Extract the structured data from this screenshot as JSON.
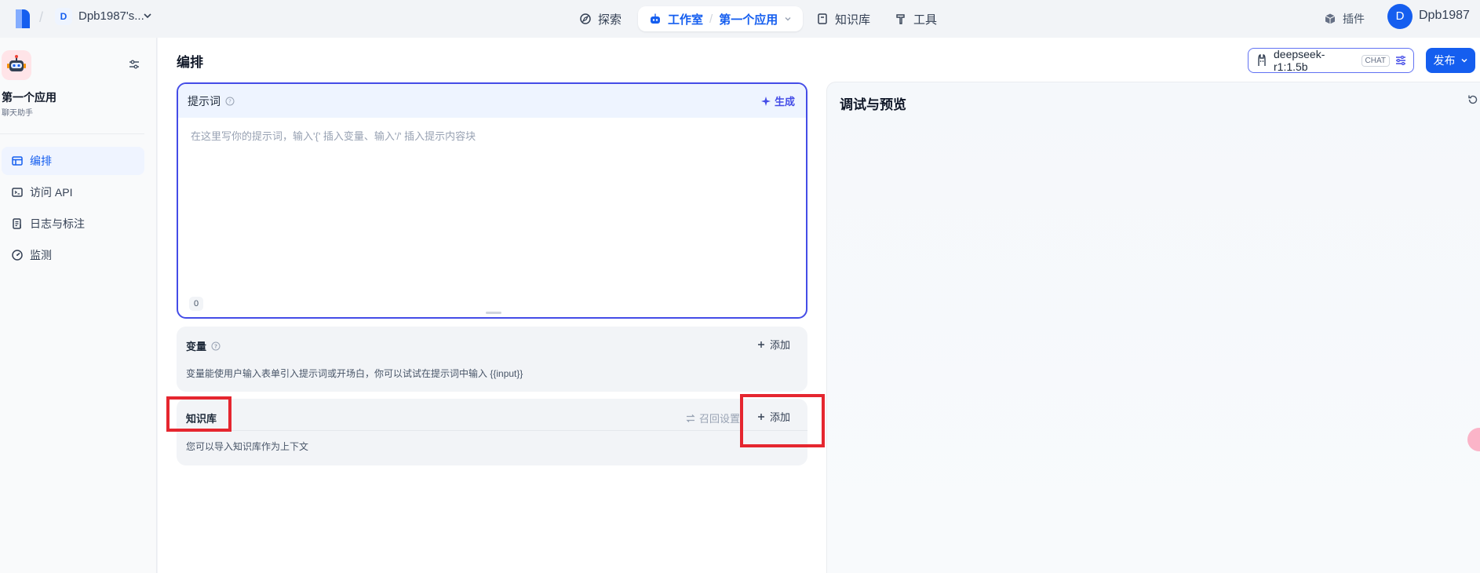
{
  "topbar": {
    "workspace_initial": "D",
    "workspace_name": "Dpb1987's...",
    "nav": {
      "explore": "探索",
      "studio": "工作室",
      "current_app": "第一个应用",
      "knowledge": "知识库",
      "tools": "工具"
    },
    "plugins": "插件",
    "user_initial": "D",
    "user_name": "Dpb1987"
  },
  "sidebar": {
    "app_title": "第一个应用",
    "app_type": "聊天助手",
    "items": [
      {
        "label": "编排",
        "icon": "layout-icon"
      },
      {
        "label": "访问 API",
        "icon": "terminal-icon"
      },
      {
        "label": "日志与标注",
        "icon": "log-icon"
      },
      {
        "label": "监测",
        "icon": "gauge-icon"
      }
    ]
  },
  "main": {
    "title": "编排",
    "model": {
      "name": "deepseek-r1:1.5b",
      "badge": "CHAT"
    },
    "publish_label": "发布",
    "prompt": {
      "title": "提示词",
      "generate_label": "生成",
      "placeholder": "在这里写你的提示词，输入'{' 插入变量、输入'/' 插入提示内容块",
      "char_count": "0"
    },
    "variables": {
      "title": "变量",
      "add_label": "添加",
      "description": "变量能使用户输入表单引入提示词或开场白，你可以试试在提示词中输入 {{input}}"
    },
    "knowledge": {
      "title": "知识库",
      "recall_label": "召回设置",
      "add_label": "添加",
      "description": "您可以导入知识库作为上下文"
    },
    "debug": {
      "title": "调试与预览"
    }
  },
  "colors": {
    "accent": "#155eef",
    "prompt_border": "#444ce7",
    "highlight": "#e5262f"
  }
}
